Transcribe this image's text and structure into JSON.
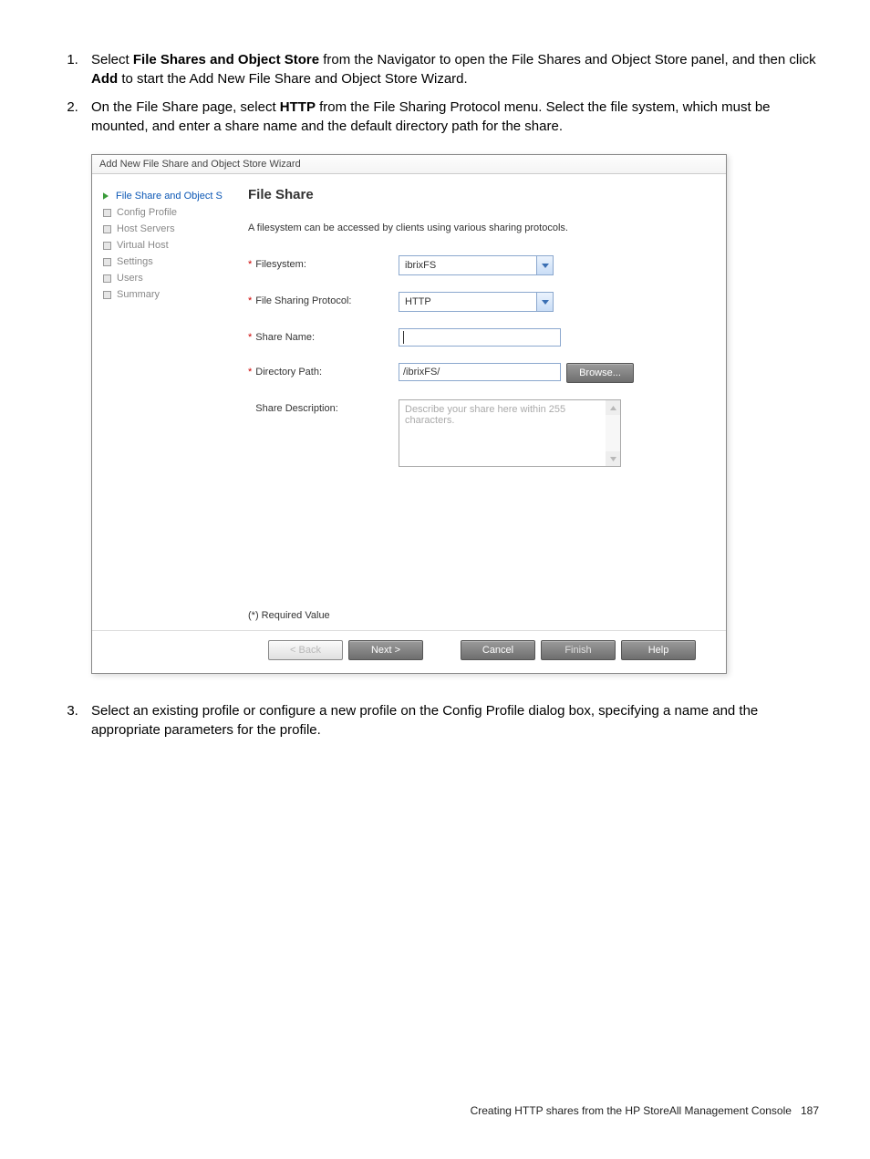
{
  "steps": {
    "s1_a": "Select ",
    "s1_b": "File Shares and Object Store",
    "s1_c": " from the Navigator to open the File Shares and Object Store panel, and then click ",
    "s1_d": "Add",
    "s1_e": " to start the Add New File Share and Object Store Wizard.",
    "s2_a": "On the File Share page, select ",
    "s2_b": "HTTP",
    "s2_c": " from the File Sharing Protocol menu. Select the file system, which must be mounted, and enter a share name and the default directory path for the share.",
    "s3": "Select an existing profile or configure a new profile on the Config Profile dialog box, specifying a name and the appropriate parameters for the profile."
  },
  "wizard": {
    "title": "Add New File Share and Object Store Wizard",
    "nav": [
      {
        "label": "File Share and Object S",
        "active": true
      },
      {
        "label": "Config Profile",
        "active": false
      },
      {
        "label": "Host Servers",
        "active": false
      },
      {
        "label": "Virtual Host",
        "active": false
      },
      {
        "label": "Settings",
        "active": false
      },
      {
        "label": "Users",
        "active": false
      },
      {
        "label": "Summary",
        "active": false
      }
    ],
    "panelTitle": "File Share",
    "panelDesc": "A filesystem can be accessed by clients using various sharing protocols.",
    "fields": {
      "filesystem": {
        "label": "Filesystem:",
        "value": "ibrixFS",
        "required": true
      },
      "protocol": {
        "label": "File Sharing Protocol:",
        "value": "HTTP",
        "required": true
      },
      "shareName": {
        "label": "Share Name:",
        "value": "",
        "required": true
      },
      "dirPath": {
        "label": "Directory Path:",
        "value": "/ibrixFS/",
        "browse": "Browse...",
        "required": true
      },
      "shareDesc": {
        "label": "Share Description:",
        "placeholder": "Describe your share here within 255 characters.",
        "required": false
      }
    },
    "requiredNote": "(*) Required Value",
    "buttons": {
      "back": "< Back",
      "next": "Next >",
      "cancel": "Cancel",
      "finish": "Finish",
      "help": "Help"
    }
  },
  "footer": {
    "text": "Creating HTTP shares from the HP StoreAll Management Console",
    "page": "187"
  }
}
